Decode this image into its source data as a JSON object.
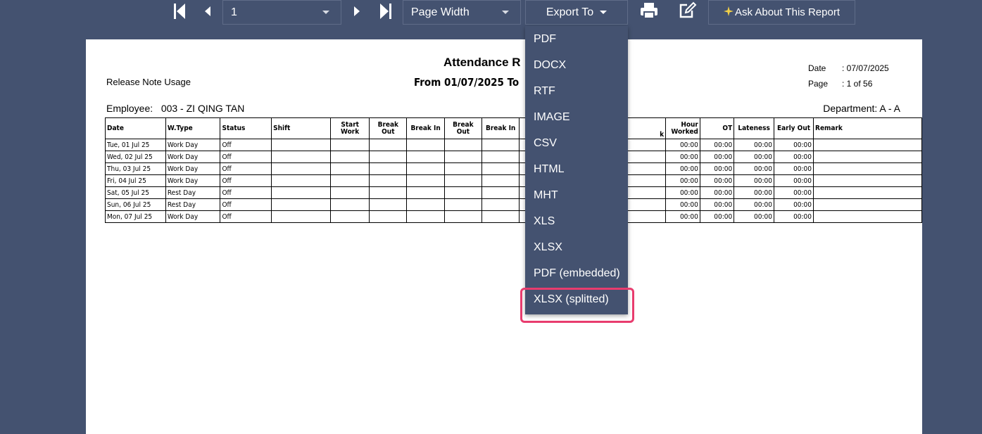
{
  "toolbar": {
    "page_value": "1",
    "zoom_value": "Page Width",
    "export_label": "Export To",
    "ask_label": "Ask About This Report"
  },
  "report": {
    "title": "Attendance R",
    "subtitle": "From 01/07/2025 To",
    "release_note": "Release Note Usage",
    "date_label": "Date",
    "date_value": ": 07/07/2025",
    "page_label": "Page",
    "page_value": ": 1 of 56",
    "employee": "Employee:   003 - ZI QING TAN",
    "department": "Department: A - A",
    "headers": [
      "Date",
      "W.Type",
      "Status",
      "Shift",
      "Start Work",
      "Break Out",
      "Break In",
      "Break Out",
      "Break In",
      "",
      "k",
      "Hour Worked",
      "OT",
      "Lateness",
      "Early Out",
      "Remark"
    ],
    "rows": [
      [
        "Tue, 01 Jul 25",
        "Work Day",
        "Off",
        "",
        "",
        "",
        "",
        "",
        "",
        "",
        "",
        "00:00",
        "00:00",
        "00:00",
        "00:00",
        ""
      ],
      [
        "Wed, 02 Jul 25",
        "Work Day",
        "Off",
        "",
        "",
        "",
        "",
        "",
        "",
        "",
        "",
        "00:00",
        "00:00",
        "00:00",
        "00:00",
        ""
      ],
      [
        "Thu, 03 Jul 25",
        "Work Day",
        "Off",
        "",
        "",
        "",
        "",
        "",
        "",
        "",
        "",
        "00:00",
        "00:00",
        "00:00",
        "00:00",
        ""
      ],
      [
        "Fri, 04 Jul 25",
        "Work Day",
        "Off",
        "",
        "",
        "",
        "",
        "",
        "",
        "",
        "",
        "00:00",
        "00:00",
        "00:00",
        "00:00",
        ""
      ],
      [
        "Sat, 05 Jul 25",
        "Rest Day",
        "Off",
        "",
        "",
        "",
        "",
        "",
        "",
        "",
        "",
        "00:00",
        "00:00",
        "00:00",
        "00:00",
        ""
      ],
      [
        "Sun, 06 Jul 25",
        "Rest Day",
        "Off",
        "",
        "",
        "",
        "",
        "",
        "",
        "",
        "",
        "00:00",
        "00:00",
        "00:00",
        "00:00",
        ""
      ],
      [
        "Mon, 07 Jul 25",
        "Work Day",
        "Off",
        "",
        "",
        "",
        "",
        "",
        "",
        "",
        "",
        "00:00",
        "00:00",
        "00:00",
        "00:00",
        ""
      ]
    ]
  },
  "export_menu": {
    "items": [
      "PDF",
      "DOCX",
      "RTF",
      "IMAGE",
      "CSV",
      "HTML",
      "MHT",
      "XLS",
      "XLSX",
      "PDF (embedded)",
      "XLSX (splitted)"
    ],
    "highlighted": "XLSX (splitted)",
    "highlight_color": "#e83c6e"
  },
  "colors": {
    "background": "#445270",
    "paper": "#ffffff"
  }
}
